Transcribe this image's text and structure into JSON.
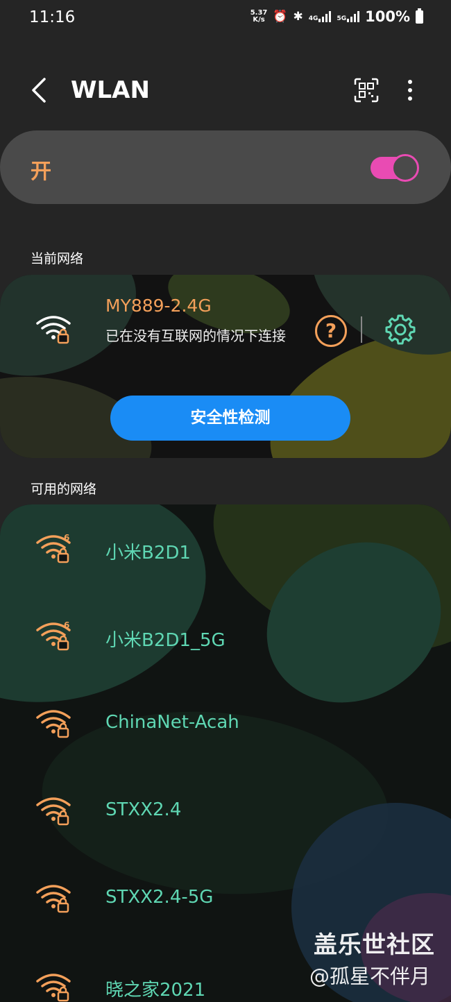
{
  "status_bar": {
    "time": "11:16",
    "net_speed_value": "5.37",
    "net_speed_unit": "K/s",
    "sim1_label": "4G",
    "sim2_label": "5G",
    "battery": "100%"
  },
  "app_bar": {
    "title": "WLAN"
  },
  "wifi_toggle": {
    "label": "开",
    "on": true
  },
  "current_section": {
    "label": "当前网络",
    "network_name": "MY889-2.4G",
    "status": "已在没有互联网的情况下连接",
    "help_glyph": "?",
    "security_button": "安全性检测"
  },
  "available_section": {
    "label": "可用的网络",
    "networks": [
      {
        "name": "小米B2D1",
        "badge": "6"
      },
      {
        "name": "小米B2D1_5G",
        "badge": "6"
      },
      {
        "name": "ChinaNet-Acah",
        "badge": ""
      },
      {
        "name": "STXX2.4",
        "badge": ""
      },
      {
        "name": "STXX2.4-5G",
        "badge": ""
      },
      {
        "name": "晓之家2021",
        "badge": ""
      }
    ]
  },
  "watermark": {
    "line1": "盖乐世社区",
    "line2": "@孤星不伴月"
  },
  "colors": {
    "accent_orange": "#f4a05a",
    "accent_pink": "#e94bb3",
    "accent_blue": "#1a8cf5",
    "network_teal": "#5fd7b3"
  }
}
